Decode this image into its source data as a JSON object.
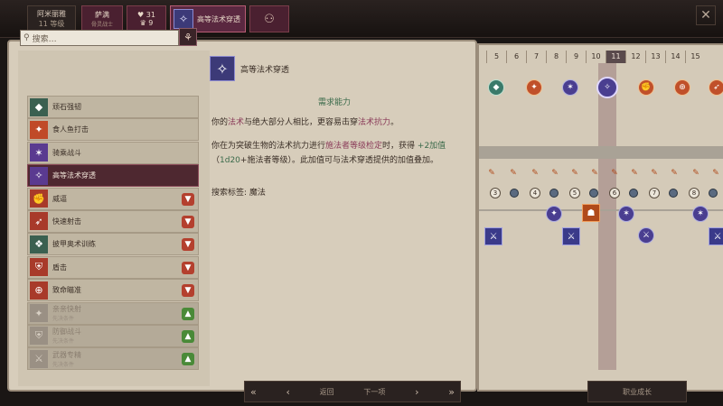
{
  "topbar": {
    "character": {
      "name": "阿米丽雅",
      "level": "11 等级"
    },
    "tabs": [
      {
        "label": "萨满",
        "sub": "骨灵战士"
      },
      {
        "label": "♥ 31",
        "sub": "♛ 9"
      },
      {
        "label": "高等法术穿透",
        "icon": "spell-icon"
      },
      {
        "label": "",
        "icon": "add-person-icon"
      }
    ],
    "close_icon": "close-icon"
  },
  "search": {
    "placeholder": "搜索…"
  },
  "feat_list": [
    {
      "label": "顽石强韧",
      "icon": "rock-icon",
      "style": "green",
      "thumb": ""
    },
    {
      "label": "食人鱼打击",
      "icon": "fish-icon",
      "style": "orange",
      "thumb": ""
    },
    {
      "label": "骑乘战斗",
      "icon": "mount-icon",
      "style": "purple",
      "thumb": ""
    },
    {
      "label": "高等法术穿透",
      "icon": "spell-icon",
      "style": "purple",
      "thumb": "",
      "selected": true
    },
    {
      "label": "威逼",
      "icon": "fist-icon",
      "style": "red",
      "thumb": "down"
    },
    {
      "label": "快速射击",
      "icon": "arrows-icon",
      "style": "red",
      "thumb": "down"
    },
    {
      "label": "披甲奥术训练",
      "icon": "arcane-icon",
      "style": "green",
      "thumb": "down"
    },
    {
      "label": "盾击",
      "icon": "shield-icon",
      "style": "red",
      "thumb": "down"
    },
    {
      "label": "致命瞄准",
      "icon": "aim-icon",
      "style": "red",
      "thumb": "down"
    },
    {
      "label": "亲亲快射",
      "sub": "先决条件",
      "style": "gray",
      "thumb": "up",
      "faded": true
    },
    {
      "label": "防御战斗",
      "sub": "先决条件",
      "style": "gray",
      "thumb": "up",
      "faded": true
    },
    {
      "label": "武器专精",
      "sub": "先决条件",
      "style": "gray",
      "thumb": "up",
      "faded": true
    }
  ],
  "detail": {
    "title": "高等法术穿透",
    "requirements_label": "需求能力",
    "p1_parts": [
      "你的",
      "法术",
      "与绝大部分人相比，更容易击穿",
      "法术抗力",
      "。"
    ],
    "p2_parts": [
      "你在为突破生物的法术抗力进行",
      "施法者等级检定",
      "时，获得 ",
      "+2加值",
      "（",
      "1d20",
      "+施法者等级）。此加值可与法术穿透提供的加值叠加。"
    ],
    "p3": "搜索标签: 魔法"
  },
  "timeline": {
    "levels": [
      "5",
      "6",
      "7",
      "8",
      "9",
      "10",
      "11",
      "12",
      "13",
      "14",
      "15"
    ],
    "current_level": "11"
  },
  "bottom": {
    "nav_back": "返回",
    "nav_next": "下一项",
    "finish": "职业成长"
  },
  "colors": {
    "accent": "#4e2830",
    "requirement": "#3a6a4a",
    "link": "#8a3a58"
  }
}
